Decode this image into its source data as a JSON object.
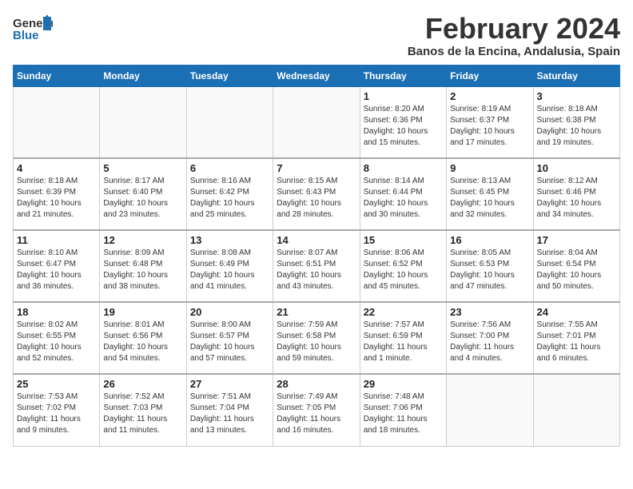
{
  "logo": {
    "general": "General",
    "blue": "Blue"
  },
  "title": "February 2024",
  "subtitle": "Banos de la Encina, Andalusia, Spain",
  "days_of_week": [
    "Sunday",
    "Monday",
    "Tuesday",
    "Wednesday",
    "Thursday",
    "Friday",
    "Saturday"
  ],
  "weeks": [
    [
      {
        "day": "",
        "info": ""
      },
      {
        "day": "",
        "info": ""
      },
      {
        "day": "",
        "info": ""
      },
      {
        "day": "",
        "info": ""
      },
      {
        "day": "1",
        "info": "Sunrise: 8:20 AM\nSunset: 6:36 PM\nDaylight: 10 hours\nand 15 minutes."
      },
      {
        "day": "2",
        "info": "Sunrise: 8:19 AM\nSunset: 6:37 PM\nDaylight: 10 hours\nand 17 minutes."
      },
      {
        "day": "3",
        "info": "Sunrise: 8:18 AM\nSunset: 6:38 PM\nDaylight: 10 hours\nand 19 minutes."
      }
    ],
    [
      {
        "day": "4",
        "info": "Sunrise: 8:18 AM\nSunset: 6:39 PM\nDaylight: 10 hours\nand 21 minutes."
      },
      {
        "day": "5",
        "info": "Sunrise: 8:17 AM\nSunset: 6:40 PM\nDaylight: 10 hours\nand 23 minutes."
      },
      {
        "day": "6",
        "info": "Sunrise: 8:16 AM\nSunset: 6:42 PM\nDaylight: 10 hours\nand 25 minutes."
      },
      {
        "day": "7",
        "info": "Sunrise: 8:15 AM\nSunset: 6:43 PM\nDaylight: 10 hours\nand 28 minutes."
      },
      {
        "day": "8",
        "info": "Sunrise: 8:14 AM\nSunset: 6:44 PM\nDaylight: 10 hours\nand 30 minutes."
      },
      {
        "day": "9",
        "info": "Sunrise: 8:13 AM\nSunset: 6:45 PM\nDaylight: 10 hours\nand 32 minutes."
      },
      {
        "day": "10",
        "info": "Sunrise: 8:12 AM\nSunset: 6:46 PM\nDaylight: 10 hours\nand 34 minutes."
      }
    ],
    [
      {
        "day": "11",
        "info": "Sunrise: 8:10 AM\nSunset: 6:47 PM\nDaylight: 10 hours\nand 36 minutes."
      },
      {
        "day": "12",
        "info": "Sunrise: 8:09 AM\nSunset: 6:48 PM\nDaylight: 10 hours\nand 38 minutes."
      },
      {
        "day": "13",
        "info": "Sunrise: 8:08 AM\nSunset: 6:49 PM\nDaylight: 10 hours\nand 41 minutes."
      },
      {
        "day": "14",
        "info": "Sunrise: 8:07 AM\nSunset: 6:51 PM\nDaylight: 10 hours\nand 43 minutes."
      },
      {
        "day": "15",
        "info": "Sunrise: 8:06 AM\nSunset: 6:52 PM\nDaylight: 10 hours\nand 45 minutes."
      },
      {
        "day": "16",
        "info": "Sunrise: 8:05 AM\nSunset: 6:53 PM\nDaylight: 10 hours\nand 47 minutes."
      },
      {
        "day": "17",
        "info": "Sunrise: 8:04 AM\nSunset: 6:54 PM\nDaylight: 10 hours\nand 50 minutes."
      }
    ],
    [
      {
        "day": "18",
        "info": "Sunrise: 8:02 AM\nSunset: 6:55 PM\nDaylight: 10 hours\nand 52 minutes."
      },
      {
        "day": "19",
        "info": "Sunrise: 8:01 AM\nSunset: 6:56 PM\nDaylight: 10 hours\nand 54 minutes."
      },
      {
        "day": "20",
        "info": "Sunrise: 8:00 AM\nSunset: 6:57 PM\nDaylight: 10 hours\nand 57 minutes."
      },
      {
        "day": "21",
        "info": "Sunrise: 7:59 AM\nSunset: 6:58 PM\nDaylight: 10 hours\nand 59 minutes."
      },
      {
        "day": "22",
        "info": "Sunrise: 7:57 AM\nSunset: 6:59 PM\nDaylight: 11 hours\nand 1 minute."
      },
      {
        "day": "23",
        "info": "Sunrise: 7:56 AM\nSunset: 7:00 PM\nDaylight: 11 hours\nand 4 minutes."
      },
      {
        "day": "24",
        "info": "Sunrise: 7:55 AM\nSunset: 7:01 PM\nDaylight: 11 hours\nand 6 minutes."
      }
    ],
    [
      {
        "day": "25",
        "info": "Sunrise: 7:53 AM\nSunset: 7:02 PM\nDaylight: 11 hours\nand 9 minutes."
      },
      {
        "day": "26",
        "info": "Sunrise: 7:52 AM\nSunset: 7:03 PM\nDaylight: 11 hours\nand 11 minutes."
      },
      {
        "day": "27",
        "info": "Sunrise: 7:51 AM\nSunset: 7:04 PM\nDaylight: 11 hours\nand 13 minutes."
      },
      {
        "day": "28",
        "info": "Sunrise: 7:49 AM\nSunset: 7:05 PM\nDaylight: 11 hours\nand 16 minutes."
      },
      {
        "day": "29",
        "info": "Sunrise: 7:48 AM\nSunset: 7:06 PM\nDaylight: 11 hours\nand 18 minutes."
      },
      {
        "day": "",
        "info": ""
      },
      {
        "day": "",
        "info": ""
      }
    ]
  ]
}
